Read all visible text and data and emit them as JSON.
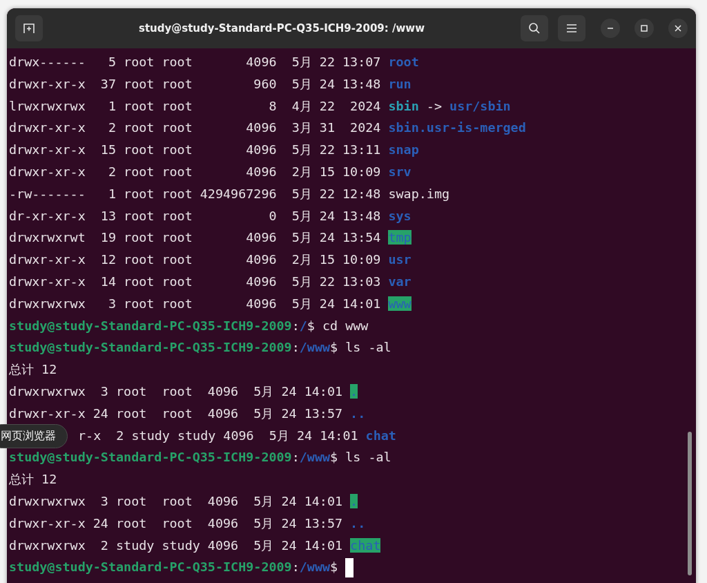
{
  "window": {
    "title": "study@study-Standard-PC-Q35-ICH9-2009: /www"
  },
  "tooltip": {
    "text": "网页浏览器"
  },
  "terminal": {
    "lines": [
      {
        "kind": "output",
        "segments": [
          {
            "text": "drwx------   5 root root       4096  5月 22 13:07 ",
            "kind": "plain"
          },
          {
            "text": "root",
            "kind": "dir"
          }
        ]
      },
      {
        "kind": "output",
        "segments": [
          {
            "text": "drwxr-xr-x  37 root root        960  5月 24 13:48 ",
            "kind": "plain"
          },
          {
            "text": "run",
            "kind": "dir"
          }
        ]
      },
      {
        "kind": "output",
        "segments": [
          {
            "text": "lrwxrwxrwx   1 root root          8  4月 22  2024 ",
            "kind": "plain"
          },
          {
            "text": "sbin",
            "kind": "link"
          },
          {
            "text": " -> ",
            "kind": "plain"
          },
          {
            "text": "usr/sbin",
            "kind": "dir"
          }
        ]
      },
      {
        "kind": "output",
        "segments": [
          {
            "text": "drwxr-xr-x   2 root root       4096  3月 31  2024 ",
            "kind": "plain"
          },
          {
            "text": "sbin.usr-is-merged",
            "kind": "dir"
          }
        ]
      },
      {
        "kind": "output",
        "segments": [
          {
            "text": "drwxr-xr-x  15 root root       4096  5月 22 13:11 ",
            "kind": "plain"
          },
          {
            "text": "snap",
            "kind": "dir"
          }
        ]
      },
      {
        "kind": "output",
        "segments": [
          {
            "text": "drwxr-xr-x   2 root root       4096  2月 15 10:09 ",
            "kind": "plain"
          },
          {
            "text": "srv",
            "kind": "dir"
          }
        ]
      },
      {
        "kind": "output",
        "segments": [
          {
            "text": "-rw-------   1 root root 4294967296  5月 22 12:48 swap.img",
            "kind": "plain"
          }
        ]
      },
      {
        "kind": "output",
        "segments": [
          {
            "text": "dr-xr-xr-x  13 root root          0  5月 24 13:48 ",
            "kind": "plain"
          },
          {
            "text": "sys",
            "kind": "dir"
          }
        ]
      },
      {
        "kind": "output",
        "segments": [
          {
            "text": "drwxrwxrwt  19 root root       4096  5月 24 13:54 ",
            "kind": "plain"
          },
          {
            "text": "tmp",
            "kind": "shared"
          }
        ]
      },
      {
        "kind": "output",
        "segments": [
          {
            "text": "drwxr-xr-x  12 root root       4096  2月 15 10:09 ",
            "kind": "plain"
          },
          {
            "text": "usr",
            "kind": "dir"
          }
        ]
      },
      {
        "kind": "output",
        "segments": [
          {
            "text": "drwxr-xr-x  14 root root       4096  5月 22 13:03 ",
            "kind": "plain"
          },
          {
            "text": "var",
            "kind": "dir"
          }
        ]
      },
      {
        "kind": "output",
        "segments": [
          {
            "text": "drwxrwxrwx   3 root root       4096  5月 24 14:01 ",
            "kind": "plain"
          },
          {
            "text": "www",
            "kind": "shared"
          }
        ]
      },
      {
        "kind": "output",
        "segments": [
          {
            "text": "study@study-Standard-PC-Q35-ICH9-2009",
            "kind": "user"
          },
          {
            "text": ":",
            "kind": "plain"
          },
          {
            "text": "/",
            "kind": "path"
          },
          {
            "text": "$ cd www",
            "kind": "plain"
          }
        ]
      },
      {
        "kind": "output",
        "segments": [
          {
            "text": "study@study-Standard-PC-Q35-ICH9-2009",
            "kind": "user"
          },
          {
            "text": ":",
            "kind": "plain"
          },
          {
            "text": "/www",
            "kind": "path"
          },
          {
            "text": "$ ls -al",
            "kind": "plain"
          }
        ]
      },
      {
        "kind": "output",
        "segments": [
          {
            "text": "总计 12",
            "kind": "plain"
          }
        ]
      },
      {
        "kind": "output",
        "segments": [
          {
            "text": "drwxrwxrwx  3 root  root  4096  5月 24 14:01 ",
            "kind": "plain"
          },
          {
            "text": ".",
            "kind": "shared"
          }
        ]
      },
      {
        "kind": "output",
        "segments": [
          {
            "text": "drwxr-xr-x 24 root  root  4096  5月 24 13:57 ",
            "kind": "plain"
          },
          {
            "text": "..",
            "kind": "dir"
          }
        ]
      },
      {
        "kind": "covered",
        "segments": [
          {
            "text": "r-x  2 study study 4096  5月 24 14:01 ",
            "kind": "plain"
          },
          {
            "text": "chat",
            "kind": "dir"
          }
        ]
      },
      {
        "kind": "output",
        "segments": [
          {
            "text": "study@study-Standard-PC-Q35-ICH9-2009",
            "kind": "user"
          },
          {
            "text": ":",
            "kind": "plain"
          },
          {
            "text": "/www",
            "kind": "path"
          },
          {
            "text": "$ ls -al",
            "kind": "plain"
          }
        ]
      },
      {
        "kind": "output",
        "segments": [
          {
            "text": "总计 12",
            "kind": "plain"
          }
        ]
      },
      {
        "kind": "output",
        "segments": [
          {
            "text": "drwxrwxrwx  3 root  root  4096  5月 24 14:01 ",
            "kind": "plain"
          },
          {
            "text": ".",
            "kind": "shared"
          }
        ]
      },
      {
        "kind": "output",
        "segments": [
          {
            "text": "drwxr-xr-x 24 root  root  4096  5月 24 13:57 ",
            "kind": "plain"
          },
          {
            "text": "..",
            "kind": "dir"
          }
        ]
      },
      {
        "kind": "output",
        "segments": [
          {
            "text": "drwxrwxrwx  2 study study 4096  5月 24 14:01 ",
            "kind": "plain"
          },
          {
            "text": "chat",
            "kind": "shared"
          }
        ]
      },
      {
        "kind": "prompt",
        "segments": [
          {
            "text": "study@study-Standard-PC-Q35-ICH9-2009",
            "kind": "user"
          },
          {
            "text": ":",
            "kind": "plain"
          },
          {
            "text": "/www",
            "kind": "path"
          },
          {
            "text": "$ ",
            "kind": "plain"
          }
        ]
      }
    ]
  }
}
